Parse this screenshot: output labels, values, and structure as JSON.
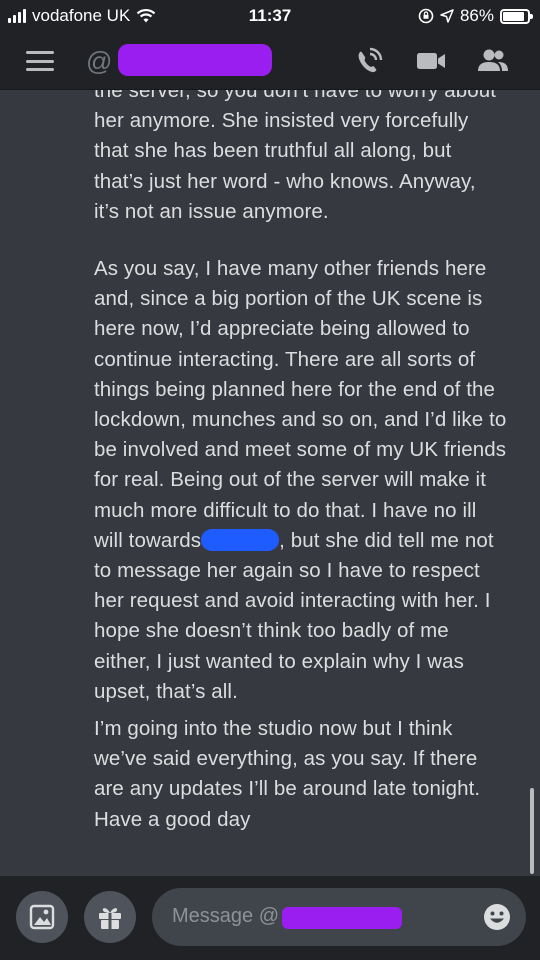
{
  "status_bar": {
    "carrier": "vodafone UK",
    "time": "11:37",
    "battery": "86%",
    "battery_level": 0.86
  },
  "header": {
    "at_symbol": "@",
    "icons": [
      "hamburger-menu-icon",
      "phone-call-icon",
      "video-camera-icon",
      "members-icon"
    ]
  },
  "messages": {
    "paragraph1": [
      "the server, so you don’t have to worry about",
      "her anymore. She insisted very forcefully",
      "that she has been truthful all along, but",
      "that’s just her word - who knows. Anyway,",
      "it’s not an issue anymore."
    ],
    "paragraph2": [
      "As you say, I have many other friends here",
      "and, since a big portion of the UK scene is",
      "here now, I’d appreciate being allowed to",
      "continue interacting. There are all sorts of",
      "things being planned here for the end of the",
      "lockdown, munches and so on, and I’d like to",
      "be involved and meet some of my UK friends",
      "for real. Being out of the server will make it",
      "much more difficult to do that. I have no ill"
    ],
    "paragraph2_redacted_line_start": "will towards",
    "paragraph2_redacted_line_end": ", but she did tell me not",
    "paragraph2_rest": [
      "to message her again so I have to respect",
      "her request and avoid interacting with her. I",
      "hope she doesn’t think too badly of me",
      "either, I just wanted to explain why I was",
      "upset, that’s all."
    ],
    "paragraph3": [
      "I’m going into the studio now but I think",
      "we’ve said everything, as you say. If there",
      "are any updates I’ll be around late tonight.",
      "Have a good day"
    ]
  },
  "composer": {
    "placeholder": "Message @",
    "icons": [
      "image-icon",
      "gift-icon",
      "emoji-icon"
    ]
  },
  "colors": {
    "background": "#36393f",
    "bar": "#202225",
    "text": "#dcddde",
    "redaction_purple": "#9b1ef0",
    "redaction_blue": "#1f5cff"
  }
}
